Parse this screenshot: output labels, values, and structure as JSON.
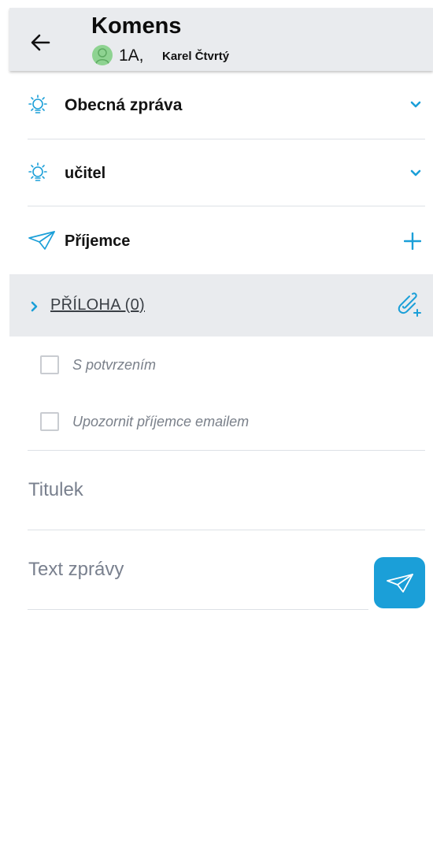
{
  "header": {
    "title": "Komens",
    "class_label": "1A,",
    "user_name": "Karel Čtvrtý"
  },
  "form": {
    "message_type": "Obecná zpráva",
    "recipient_group": "učitel",
    "recipients_label": "Příjemce",
    "attachments_label": "PŘÍLOHA (0)",
    "checkbox_confirmation": "S potvrzením",
    "checkbox_notify_email": "Upozornit příjemce emailem",
    "title_placeholder": "Titulek",
    "body_placeholder": "Text zprávy"
  },
  "icons": {
    "back": "arrow-left-icon",
    "message_type": "lightbulb-icon",
    "recipient_group": "lightbulb-icon",
    "recipients": "paper-plane-icon",
    "add_recipient": "plus-icon",
    "expand": "chevron-down-icon",
    "attachment_expand": "chevron-right-icon",
    "add_attachment": "paperclip-plus-icon",
    "send": "paper-plane-icon",
    "avatar": "user-avatar-icon"
  },
  "colors": {
    "accent": "#1b9fd8",
    "header_bg": "#e9ebee",
    "avatar_bg": "#8ed391",
    "muted_text": "#79808e"
  }
}
